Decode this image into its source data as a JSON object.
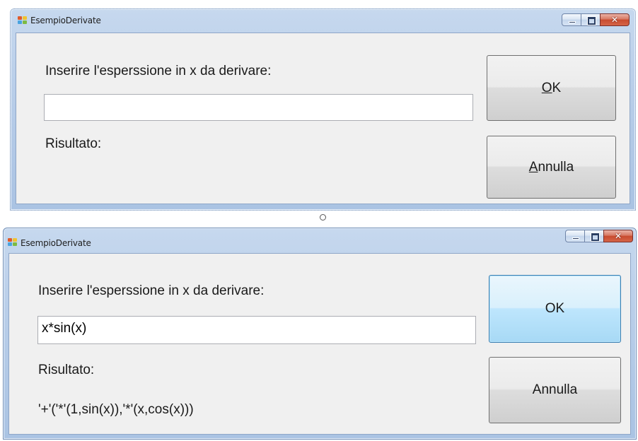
{
  "window1": {
    "title": "EsempioDerivate",
    "prompt_label": "Inserire l'esperssione in x da derivare:",
    "input_value": "",
    "result_label": "Risultato:",
    "result_value": "",
    "ok_mnemonic": "O",
    "ok_rest": "K",
    "cancel_mnemonic": "A",
    "cancel_rest": "nnulla"
  },
  "window2": {
    "title": "EsempioDerivate",
    "prompt_label": "Inserire l'esperssione in x da derivare:",
    "input_value": "x*sin(x)",
    "result_label": "Risultato:",
    "result_value": "'+'('*'(1,sin(x)),'*'(x,cos(x)))",
    "ok_label": "OK",
    "cancel_label": "Annulla"
  },
  "icons": {
    "app": "winforms-app-icon",
    "minimize": "minimize-icon",
    "maximize": "maximize-icon",
    "close": "close-icon"
  },
  "colors": {
    "titlebar": "#b9cee9",
    "client": "#f0f0f0",
    "close_button": "#c84b2f",
    "focus_button": "#3c7fb1"
  }
}
